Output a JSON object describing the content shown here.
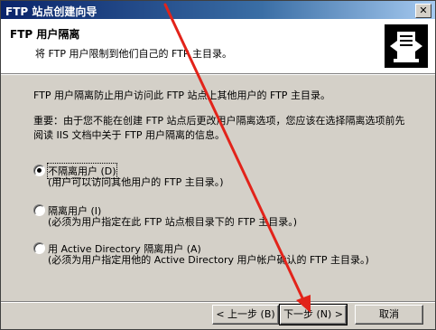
{
  "window": {
    "title": "FTP 站点创建向导",
    "close_glyph": "✕"
  },
  "header": {
    "title": "FTP 用户隔离",
    "subtitle": "将 FTP 用户限制到他们自己的 FTP 主目录。",
    "icon": "ftp-server-icon"
  },
  "body": {
    "intro": "FTP 用户隔离防止用户访问此 FTP 站点上其他用户的 FTP 主目录。",
    "note": "重要：由于您不能在创建 FTP 站点后更改用户隔离选项，您应该在选择隔离选项前先阅读 IIS 文档中关于 FTP 用户隔离的信息。"
  },
  "options": [
    {
      "label": "不隔离用户 (D)",
      "desc": "(用户可以访问其他用户的 FTP 主目录。)",
      "checked": true
    },
    {
      "label": "隔离用户 (I)",
      "desc": "(必须为用户指定在此 FTP 站点根目录下的 FTP 主目录。)",
      "checked": false
    },
    {
      "label": "用 Active Directory 隔离用户 (A)",
      "desc": "(必须为用户指定用他的 Active Directory 用户帐户确认的 FTP 主目录。)",
      "checked": false
    }
  ],
  "buttons": {
    "back": "< 上一步 (B)",
    "next": "下一步 (N) >",
    "cancel": "取消"
  },
  "colors": {
    "annotation_arrow": "#e2231a",
    "title_bar": "#0a246a"
  }
}
